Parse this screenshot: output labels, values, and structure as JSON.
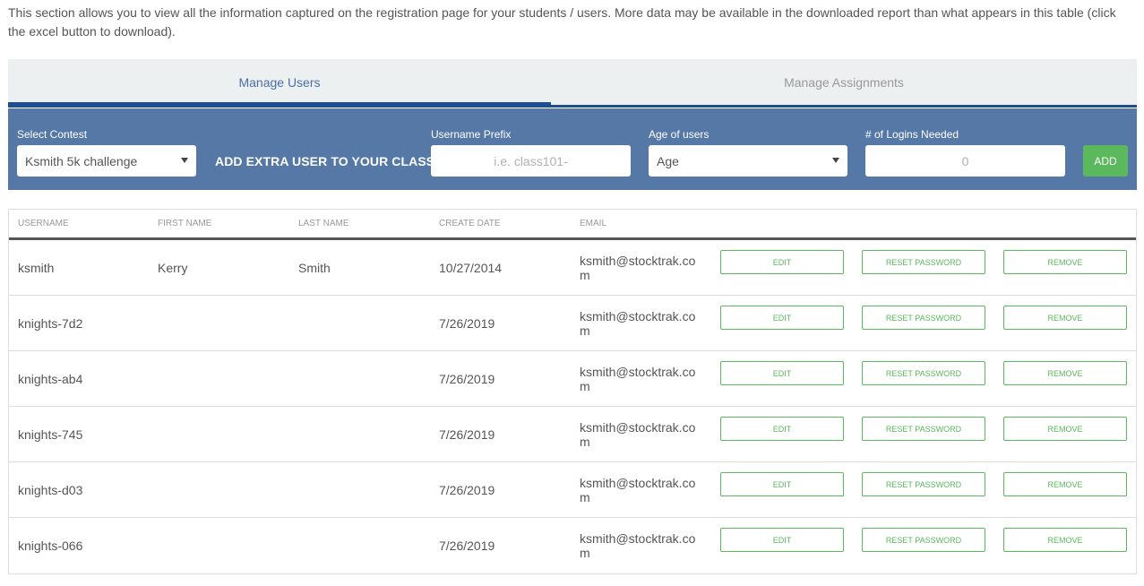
{
  "intro": "This section allows you to view all the information captured on the registration page for your students / users. More data may be available in the downloaded report than what appears in this table (click the excel button to download).",
  "tabs": [
    {
      "label": "Manage Users",
      "active": true
    },
    {
      "label": "Manage Assignments",
      "active": false
    }
  ],
  "toolbar": {
    "contest_label": "Select Contest",
    "contest_value": "Ksmith 5k challenge",
    "extra_label": "ADD EXTRA USER TO YOUR CLASS:",
    "prefix_label": "Username Prefix",
    "prefix_placeholder": "i.e. class101-",
    "age_label": "Age of users",
    "age_value": "Age",
    "logins_label": "# of Logins Needed",
    "logins_placeholder": "0",
    "add_label": "ADD"
  },
  "table": {
    "headers": [
      "USERNAME",
      "FIRST NAME",
      "LAST NAME",
      "CREATE DATE",
      "EMAIL"
    ],
    "actions": {
      "edit": "EDIT",
      "reset": "RESET PASSWORD",
      "remove": "REMOVE"
    },
    "rows": [
      {
        "username": "ksmith",
        "first": "Kerry",
        "last": "Smith",
        "date": "10/27/2014",
        "email": "ksmith@stocktrak.com"
      },
      {
        "username": "knights-7d2",
        "first": "",
        "last": "",
        "date": "7/26/2019",
        "email": "ksmith@stocktrak.com"
      },
      {
        "username": "knights-ab4",
        "first": "",
        "last": "",
        "date": "7/26/2019",
        "email": "ksmith@stocktrak.com"
      },
      {
        "username": "knights-745",
        "first": "",
        "last": "",
        "date": "7/26/2019",
        "email": "ksmith@stocktrak.com"
      },
      {
        "username": "knights-d03",
        "first": "",
        "last": "",
        "date": "7/26/2019",
        "email": "ksmith@stocktrak.com"
      },
      {
        "username": "knights-066",
        "first": "",
        "last": "",
        "date": "7/26/2019",
        "email": "ksmith@stocktrak.com"
      }
    ]
  },
  "colors": {
    "toolbar_bg": "#5578a6",
    "accent_green": "#5cb85c",
    "tab_underline": "#1e4e8c"
  }
}
